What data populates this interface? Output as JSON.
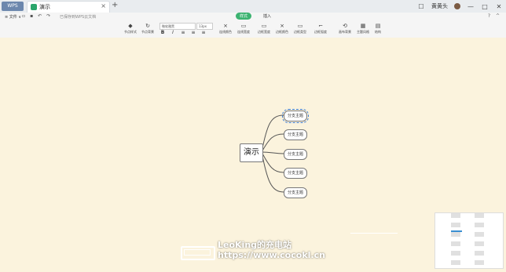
{
  "titlebar": {
    "app_tab": "WPS",
    "doc_tab": "演示",
    "close": "×",
    "add": "+",
    "user": "黄黄头",
    "icons": {
      "window": "☐",
      "min": "—",
      "max": "□",
      "close": "✕"
    }
  },
  "menu": {
    "file": "≡ 文件 ∨",
    "hint": "已保存到WPS云文档",
    "tabs": [
      "样式",
      "插入"
    ],
    "active_tab": "样式",
    "help": "?",
    "collapse": "^"
  },
  "ribbon": {
    "buttons": [
      {
        "glyph": "◆",
        "label": "节点样式"
      },
      {
        "glyph": "↻",
        "label": "节点背景"
      },
      {
        "glyph": "⨯",
        "label": "连线颜色"
      },
      {
        "glyph": "▭",
        "label": "连线宽度"
      },
      {
        "glyph": "▭",
        "label": "边框宽度"
      },
      {
        "glyph": "⨯",
        "label": "边框颜色"
      },
      {
        "glyph": "▭",
        "label": "边框类型"
      },
      {
        "glyph": "⌐",
        "label": "边框弧度"
      },
      {
        "glyph": "⟲",
        "label": "画布背景"
      },
      {
        "glyph": "▦",
        "label": "主题风格"
      },
      {
        "glyph": "▤",
        "label": "结构"
      }
    ],
    "font": "微软雅黑",
    "font_size": "13px",
    "format": [
      "B",
      "I",
      "≡",
      "≡",
      "≡"
    ]
  },
  "mindmap": {
    "central": "演示",
    "branches": [
      "分支主题",
      "分支主题",
      "分支主题",
      "分支主题",
      "分支主题"
    ],
    "selected_index": 0
  },
  "watermark": {
    "line1": "LeoKing的充电站",
    "line2": "https://www.cocokl.cn"
  },
  "colors": {
    "canvas": "#fbf3dd",
    "accent": "#3cb371",
    "wps_tab": "#6c87ad"
  }
}
